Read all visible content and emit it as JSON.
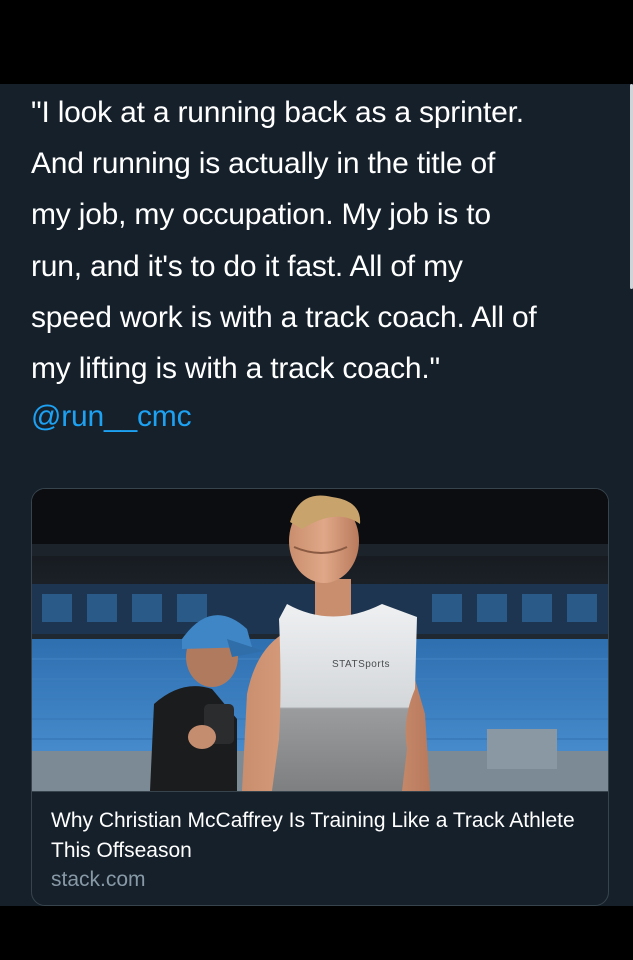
{
  "tweet": {
    "text_lines": [
      "\"I look at a running back as a sprinter.",
      "And running is actually in the title of",
      "my job, my occupation. My job is to",
      "run, and it's to do it fast. All of my",
      "speed work is with a track coach. All of",
      "my lifting is with a track coach.\""
    ],
    "mention": "@run__cmc"
  },
  "card": {
    "title": "Why Christian McCaffrey Is Training Like a Track Athlete This Offseason",
    "domain": "stack.com",
    "shirt_logo_text": "STATSports"
  },
  "colors": {
    "background": "#15202b",
    "text": "#ffffff",
    "link": "#1da1f2",
    "secondary_text": "#8899a6",
    "border": "#38444d"
  }
}
